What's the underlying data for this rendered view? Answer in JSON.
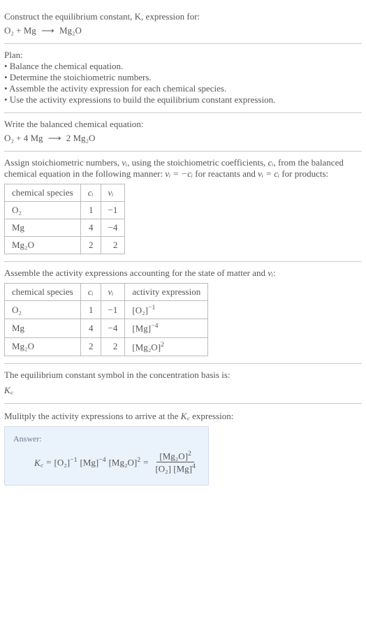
{
  "intro": {
    "line1": "Construct the equilibrium constant, K, expression for:",
    "reaction_lhs": "O₂ + Mg",
    "arrow": "⟶",
    "reaction_rhs": "Mg₂O"
  },
  "plan": {
    "heading": "Plan:",
    "b1": "• Balance the chemical equation.",
    "b2": "• Determine the stoichiometric numbers.",
    "b3": "• Assemble the activity expression for each chemical species.",
    "b4": "• Use the activity expressions to build the equilibrium constant expression."
  },
  "balanced": {
    "heading": "Write the balanced chemical equation:",
    "lhs": "O₂ + 4 Mg",
    "arrow": "⟶",
    "rhs": "2 Mg₂O"
  },
  "stoich": {
    "text_a": "Assign stoichiometric numbers, ",
    "nu": "νᵢ",
    "text_b": ", using the stoichiometric coefficients, ",
    "ci": "cᵢ",
    "text_c": ", from the balanced chemical equation in the following manner: ",
    "rel_react": "νᵢ = −cᵢ",
    "text_d": " for reactants and ",
    "rel_prod": "νᵢ = cᵢ",
    "text_e": " for products:",
    "headers": {
      "h1": "chemical species",
      "h2": "cᵢ",
      "h3": "νᵢ"
    },
    "rows": [
      {
        "sp": "O₂",
        "c": "1",
        "v": "−1"
      },
      {
        "sp": "Mg",
        "c": "4",
        "v": "−4"
      },
      {
        "sp": "Mg₂O",
        "c": "2",
        "v": "2"
      }
    ]
  },
  "activity": {
    "heading_a": "Assemble the activity expressions accounting for the state of matter and ",
    "nu": "νᵢ",
    "heading_b": ":",
    "headers": {
      "h1": "chemical species",
      "h2": "cᵢ",
      "h3": "νᵢ",
      "h4": "activity expression"
    },
    "rows": [
      {
        "sp": "O₂",
        "c": "1",
        "v": "−1",
        "ae_base": "[O₂]",
        "ae_exp": "−1"
      },
      {
        "sp": "Mg",
        "c": "4",
        "v": "−4",
        "ae_base": "[Mg]",
        "ae_exp": "−4"
      },
      {
        "sp": "Mg₂O",
        "c": "2",
        "v": "2",
        "ae_base": "[Mg₂O]",
        "ae_exp": "2"
      }
    ]
  },
  "symbol": {
    "heading": "The equilibrium constant symbol in the concentration basis is:",
    "kc": "K꜀"
  },
  "multiply": {
    "heading_a": "Mulitply the activity expressions to arrive at the ",
    "kc": "K꜀",
    "heading_b": " expression:"
  },
  "answer": {
    "label": "Answer:",
    "kc": "K꜀",
    "eq": " = ",
    "t1": "[O₂]",
    "e1": "−1",
    "t2": "[Mg]",
    "e2": "−4",
    "t3": "[Mg₂O]",
    "e3": "2",
    "eq2": " = ",
    "num_base": "[Mg₂O]",
    "num_exp": "2",
    "den_a": "[O₂]",
    "den_b": "[Mg]",
    "den_b_exp": "4"
  },
  "chart_data": {
    "type": "table",
    "tables": [
      {
        "title": "stoichiometric numbers",
        "columns": [
          "chemical species",
          "c_i",
          "ν_i"
        ],
        "rows": [
          [
            "O2",
            1,
            -1
          ],
          [
            "Mg",
            4,
            -4
          ],
          [
            "Mg2O",
            2,
            2
          ]
        ]
      },
      {
        "title": "activity expressions",
        "columns": [
          "chemical species",
          "c_i",
          "ν_i",
          "activity expression"
        ],
        "rows": [
          [
            "O2",
            1,
            -1,
            "[O2]^-1"
          ],
          [
            "Mg",
            4,
            -4,
            "[Mg]^-4"
          ],
          [
            "Mg2O",
            2,
            2,
            "[Mg2O]^2"
          ]
        ]
      }
    ],
    "balanced_equation": "O2 + 4 Mg -> 2 Mg2O",
    "Kc": "[Mg2O]^2 / ([O2] * [Mg]^4)"
  }
}
